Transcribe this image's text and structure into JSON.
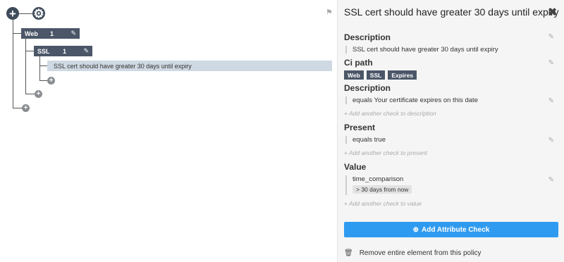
{
  "tree": {
    "add_symbol": "+",
    "gear_symbol": "⚙",
    "nodes": [
      {
        "label": "Web",
        "count": "1",
        "edit_symbol": "✎"
      },
      {
        "label": "SSL",
        "count": "1",
        "edit_symbol": "✎"
      }
    ],
    "leaf": "SSL cert should have greater 30 days until expiry",
    "small_add_symbol": "+"
  },
  "panel": {
    "title": "SSL cert should have greater 30 days until expiry",
    "close_symbol": "✖",
    "pencil_symbol": "✎",
    "sections": {
      "description_1": {
        "heading": "Description",
        "text": "SSL cert should have greater 30 days until expiry"
      },
      "ci_path": {
        "heading": "Ci path",
        "chips": [
          "Web",
          "SSL",
          "Expires"
        ]
      },
      "description_2": {
        "heading": "Description",
        "check": "equals Your certificate expires on this date",
        "add": "Add another check to description"
      },
      "present": {
        "heading": "Present",
        "check": "equals true",
        "add": "Add another check to present"
      },
      "value": {
        "heading": "Value",
        "check": "time_comparison",
        "badge": "> 30 days from now",
        "add": "Add another check to value"
      }
    },
    "add_attribute_label": "Add Attribute Check",
    "remove_label": "Remove entire element from this policy"
  },
  "colors": {
    "accent": "#2f9bf0",
    "node_bg": "#4b5768",
    "leaf_bg": "#cfd9e3",
    "panel_bg": "#f5f5f5"
  }
}
